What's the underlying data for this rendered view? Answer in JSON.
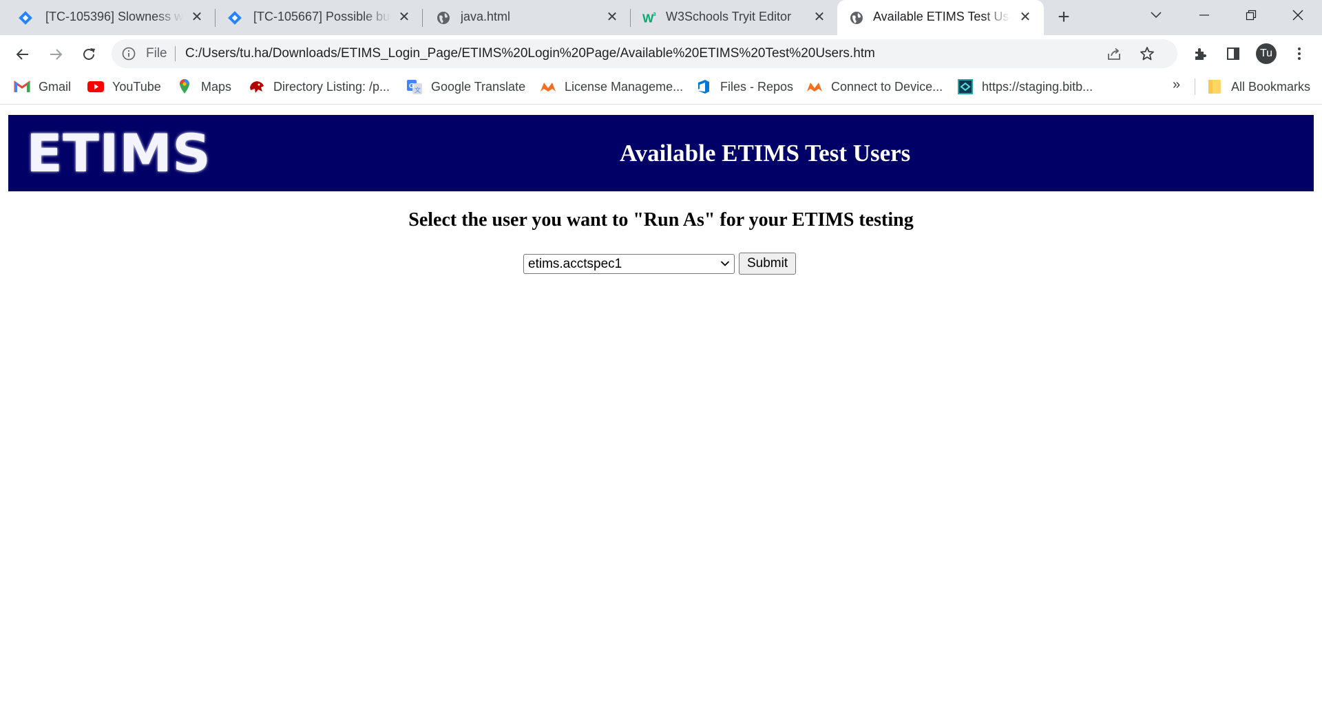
{
  "browser": {
    "tabs": [
      {
        "title": "[TC-105396] Slowness wh",
        "icon": "jira-icon",
        "active": false
      },
      {
        "title": "[TC-105667] Possible bug",
        "icon": "jira-icon",
        "active": false
      },
      {
        "title": "java.html",
        "icon": "globe-icon",
        "active": false
      },
      {
        "title": "W3Schools Tryit Editor",
        "icon": "w3schools-icon",
        "active": false
      },
      {
        "title": "Available ETIMS Test Users",
        "icon": "globe-icon",
        "active": true
      }
    ],
    "address_bar": {
      "scheme": "File",
      "url": "C:/Users/tu.ha/Downloads/ETIMS_Login_Page/ETIMS%20Login%20Page/Available%20ETIMS%20Test%20Users.htm"
    },
    "profile_initials": "Tu",
    "bookmarks": [
      {
        "label": "Gmail",
        "icon": "gmail-icon"
      },
      {
        "label": "YouTube",
        "icon": "youtube-icon"
      },
      {
        "label": "Maps",
        "icon": "maps-icon"
      },
      {
        "label": "Directory Listing: /p...",
        "icon": "directory-icon"
      },
      {
        "label": "Google Translate",
        "icon": "translate-icon"
      },
      {
        "label": "License Manageme...",
        "icon": "license-icon"
      },
      {
        "label": "Files - Repos",
        "icon": "repos-icon"
      },
      {
        "label": "Connect to Device...",
        "icon": "connect-icon"
      },
      {
        "label": "https://staging.bitb...",
        "icon": "bitbucket-icon"
      }
    ],
    "overflow_label": "»",
    "all_bookmarks_label": "All Bookmarks",
    "colors": {
      "tabstrip": "#dee1e6",
      "omnibox": "#f1f3f4"
    }
  },
  "page": {
    "logo_text": "ETIMS",
    "banner_title": "Available ETIMS Test Users",
    "prompt": "Select the user you want to \"Run As\" for your ETIMS testing",
    "user_select": {
      "selected": "etims.acctspec1"
    },
    "submit_label": "Submit",
    "colors": {
      "banner": "#000066",
      "banner_text": "#ffffff"
    }
  }
}
